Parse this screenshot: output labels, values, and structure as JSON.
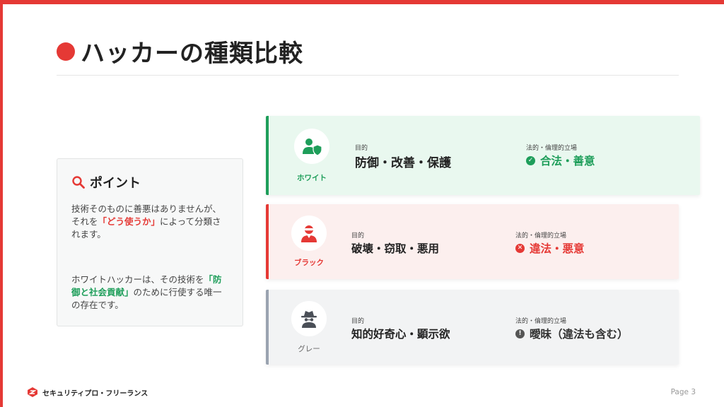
{
  "title": "ハッカーの種類比較",
  "point": {
    "heading": "ポイント",
    "para1_a": "技術そのものに善悪はありませんが、それを",
    "para1_hl": "「どう使うか」",
    "para1_b": "によって分類されます。",
    "para2_a": "ホワイトハッカーは、その技術を",
    "para2_hl": "「防御と社会貢献」",
    "para2_b": "のために行使する唯一の存在です。"
  },
  "cards": [
    {
      "badge": "ホワイト",
      "purpose_label": "目的",
      "purpose": "防御・改善・保護",
      "stance_label": "法的・倫理的立場",
      "stance": "合法・善意",
      "stance_icon": "check-circle-icon"
    },
    {
      "badge": "ブラック",
      "purpose_label": "目的",
      "purpose": "破壊・窃取・悪用",
      "stance_label": "法的・倫理的立場",
      "stance": "違法・悪意",
      "stance_icon": "x-circle-icon"
    },
    {
      "badge": "グレー",
      "purpose_label": "目的",
      "purpose": "知的好奇心・顕示欲",
      "stance_label": "法的・倫理的立場",
      "stance": "曖昧（違法も含む）",
      "stance_icon": "exclamation-circle-icon"
    }
  ],
  "footer": {
    "brand": "セキュリティプロ・フリーランス",
    "page": "Page 3"
  },
  "colors": {
    "accent_red": "#e53935",
    "green": "#1e9e5a",
    "grey": "#9aa3b0"
  }
}
